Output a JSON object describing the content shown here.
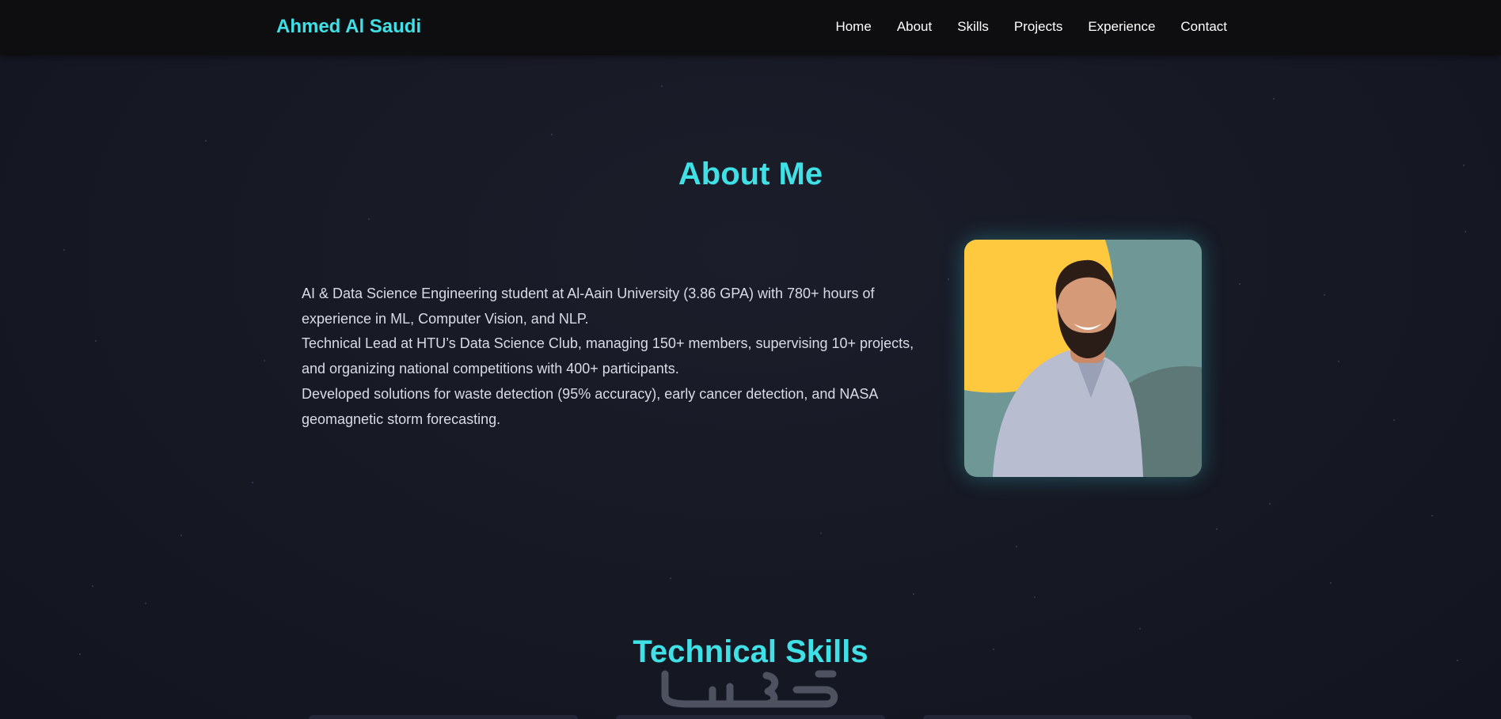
{
  "brand": "Ahmed Al Saudi",
  "nav": {
    "home": "Home",
    "about": "About",
    "skills": "Skills",
    "projects": "Projects",
    "experience": "Experience",
    "contact": "Contact"
  },
  "about": {
    "title": "About Me",
    "paragraphs": [
      "AI & Data Science Engineering student at Al-Aain University (3.86 GPA) with 780+ hours of experience in ML, Computer Vision, and NLP.",
      "Technical Lead at HTU’s Data Science Club, managing 150+ members, supervising 10+ projects, and organizing national competitions with 400+ participants.",
      "Developed solutions for waste detection (95% accuracy), early cancer detection, and NASA geomagnetic storm forecasting."
    ],
    "photo_alt": "Ahmed Al Saudi"
  },
  "skills": {
    "title": "Technical Skills"
  },
  "watermark": "خمسات",
  "colors": {
    "accent": "#3fe0e6",
    "navbar_bg": "#0e0e10",
    "page_bg": "#161823",
    "body_text": "#d9dce6",
    "photo_yellow": "#ffc93f",
    "photo_teal": "#6e9795"
  }
}
